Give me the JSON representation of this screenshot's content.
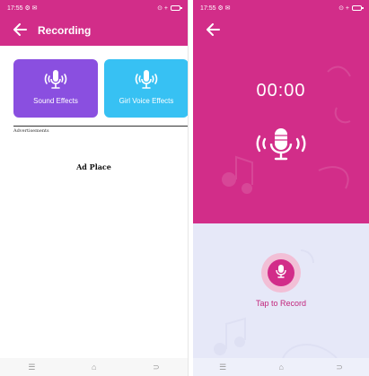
{
  "left_screen": {
    "status": {
      "time": "17:55 ⚙ ✉",
      "indicators": "⊙ +"
    },
    "appbar": {
      "back_label": "🡐",
      "title": "Recording"
    },
    "cards": [
      {
        "label": "Sound Effects",
        "color": "#8a4fe0",
        "icon": "microphone-icon"
      },
      {
        "label": "Girl Voice Effects",
        "color": "#37c1f3",
        "icon": "microphone-icon"
      }
    ],
    "ad": {
      "label": "Advertisements",
      "placeholder": "Ad Place"
    },
    "nav": {
      "menu": "☰",
      "home": "⌂",
      "back": "⊃"
    }
  },
  "right_screen": {
    "status": {
      "time": "17:55 ⚙ ✉",
      "indicators": "⊙ +"
    },
    "appbar": {
      "back_label": "🡐"
    },
    "timer": "00:00",
    "record_label": "Tap to Record",
    "nav": {
      "menu": "☰",
      "home": "⌂",
      "back": "⊃"
    }
  },
  "colors": {
    "primary": "#d22d89",
    "purple": "#8a4fe0",
    "blue": "#37c1f3",
    "light": "#e6e8f8"
  }
}
